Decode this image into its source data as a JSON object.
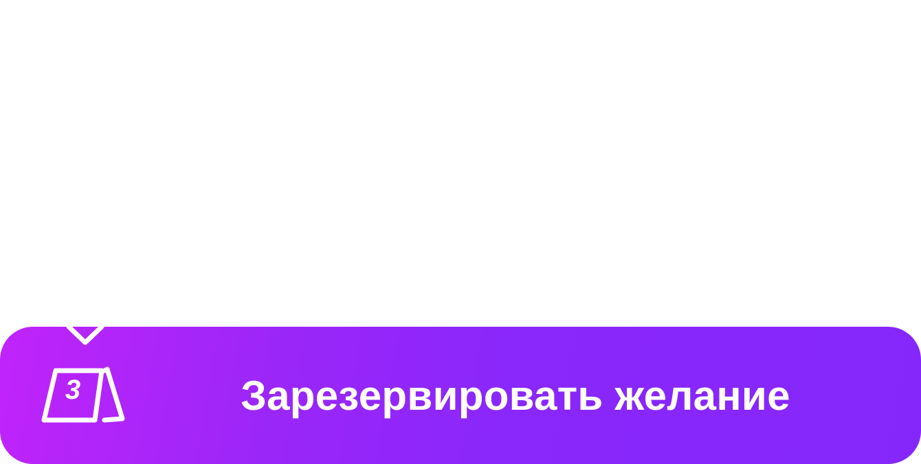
{
  "reserve_button": {
    "label": "Зарезервировать желание",
    "step_number": "3",
    "icon": "tent-card-icon",
    "gradient_start": "#c024fb",
    "gradient_end": "#8527fb",
    "text_color": "#ffffff"
  }
}
